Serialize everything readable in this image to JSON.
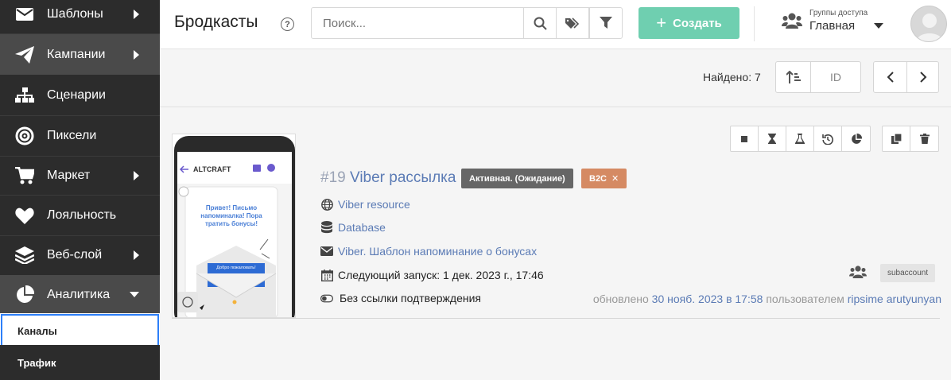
{
  "sidebar": {
    "items": [
      {
        "label": "Шаблоны",
        "icon": "envelope-icon"
      },
      {
        "label": "Кампании",
        "icon": "paper-plane-icon"
      },
      {
        "label": "Сценарии",
        "icon": "sitemap-icon"
      },
      {
        "label": "Пиксели",
        "icon": "target-icon"
      },
      {
        "label": "Маркет",
        "icon": "cart-icon"
      },
      {
        "label": "Лояльность",
        "icon": "heart-icon"
      },
      {
        "label": "Веб-слой",
        "icon": "layers-icon"
      },
      {
        "label": "Аналитика",
        "icon": "pie-chart-icon"
      }
    ],
    "subitems": [
      {
        "label": "Каналы"
      },
      {
        "label": "Трафик"
      }
    ]
  },
  "header": {
    "title": "Бродкасты",
    "help": "?",
    "search_placeholder": "Поиск...",
    "create_label": "Создать",
    "groups_label": "Группы доступа",
    "groups_value": "Главная"
  },
  "toolbar": {
    "found": "Найдено: 7",
    "sort_field": "ID"
  },
  "campaign": {
    "id": "#19",
    "name": "Viber рассылка",
    "status": "Активная. (Ожидание)",
    "tag": "B2C",
    "resource": "Viber resource",
    "database": "Database",
    "template": "Viber. Шаблон напоминание о бонусах",
    "next_run": "Следующий запуск: 1 дек. 2023 г., 17:46",
    "no_confirm": "Без ссылки подтверждения",
    "subaccount": "subaccount",
    "updated_prefix": "обновлено",
    "updated_date": "30 нояб. 2023 в 17:58",
    "updated_by_prefix": "пользователем",
    "updated_user": "ripsime arutyunyan"
  },
  "preview": {
    "brand": "ALTCRAFT",
    "message": "Привет! Письмо напоминалка! Пора тратить бонусы!",
    "envelope_text": "Добро пожаловать!"
  }
}
